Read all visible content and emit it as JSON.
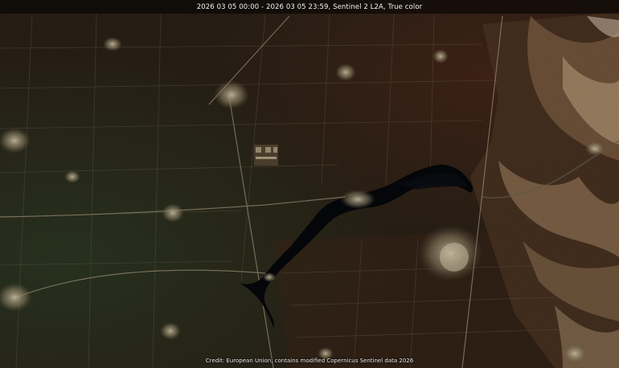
{
  "header": {
    "title": "2026 03 05 00:00 - 2026 03 05 23:59, Sentinel 2 L2A, True color"
  },
  "map": {
    "layer": "True color",
    "water_color": "#05070a",
    "terrain_color": "#2a2116",
    "highland_color": "#8a6a4a",
    "settlement_color": "#cfc2a2"
  },
  "footer": {
    "credit": "Credit: European Union, contains modified Copernicus Sentinel data 2026"
  }
}
